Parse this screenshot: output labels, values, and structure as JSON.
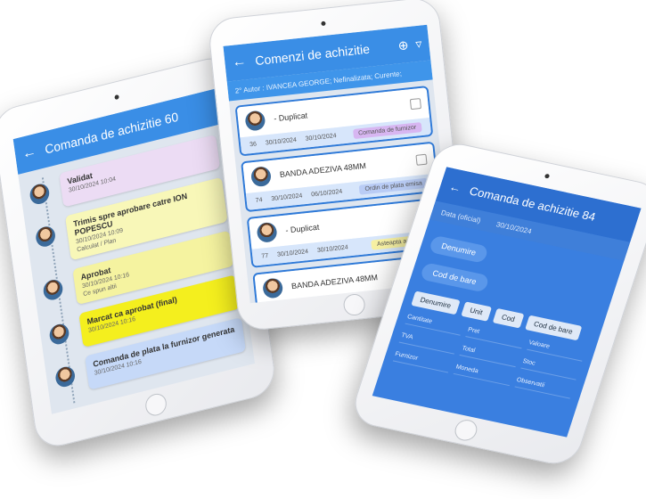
{
  "tablet_left": {
    "title": "Comanda de achizitie 60",
    "timeline": [
      {
        "title": "Validat",
        "sub": "30/10/2024 10:04",
        "color": "#ecdcf4"
      },
      {
        "title": "Trimis spre aprobare catre ION POPESCU",
        "sub": "30/10/2024 10:09",
        "sub2": "Calculat / Plan",
        "color": "#f8f7b8"
      },
      {
        "title": "Aprobat",
        "sub": "30/10/2024 10:16",
        "sub2": "Ce spun altii",
        "color": "#f5f3a0"
      },
      {
        "title": "Marcat ca aprobat (final)",
        "sub": "30/10/2024 10:16",
        "color": "#f4ef1e"
      },
      {
        "title": "Comanda de plata la furnizor generata",
        "sub": "30/10/2024 10:16",
        "color": "#c6d9f8"
      }
    ]
  },
  "tablet_center": {
    "title": "Comenzi de achizitie",
    "subtitle": "2° Autor : IVANCEA GEORGE; Nefinalizata; Curente;",
    "cards": [
      {
        "name": "- Duplicat",
        "num": "36",
        "d1": "30/10/2024",
        "d2": "30/10/2024",
        "chip": "Comanda de furnizor",
        "chip_color": "#d7b6f1"
      },
      {
        "name": "BANDA ADEZIVA 48MM",
        "num": "74",
        "d1": "30/10/2024",
        "d2": "06/10/2024",
        "chip": "Ordin de plata emisa",
        "chip_color": "#b9ccf5"
      },
      {
        "name": "- Duplicat",
        "num": "77",
        "d1": "30/10/2024",
        "d2": "30/10/2024",
        "chip": "Asteapta aprobare",
        "chip_color": "#f7f1a3"
      },
      {
        "name": "BANDA ADEZIVA 48MM",
        "num": "",
        "d1": "",
        "d2": "",
        "chip": "",
        "chip_color": "#ffffff"
      }
    ]
  },
  "tablet_right": {
    "title": "Comanda de achizitie 84",
    "sub_label": "Data (oficial)",
    "sub_value": "30/10/2024",
    "pills": [
      "Denumire",
      "Cod de bare"
    ],
    "tabs": [
      "Denumire",
      "Unit",
      "Cod",
      "Cod de bare"
    ],
    "grid": [
      "Cantitate",
      "Pret",
      "Valoare",
      "TVA",
      "Total",
      "Stoc",
      "Furnizor",
      "Moneda",
      "Observatii"
    ]
  }
}
